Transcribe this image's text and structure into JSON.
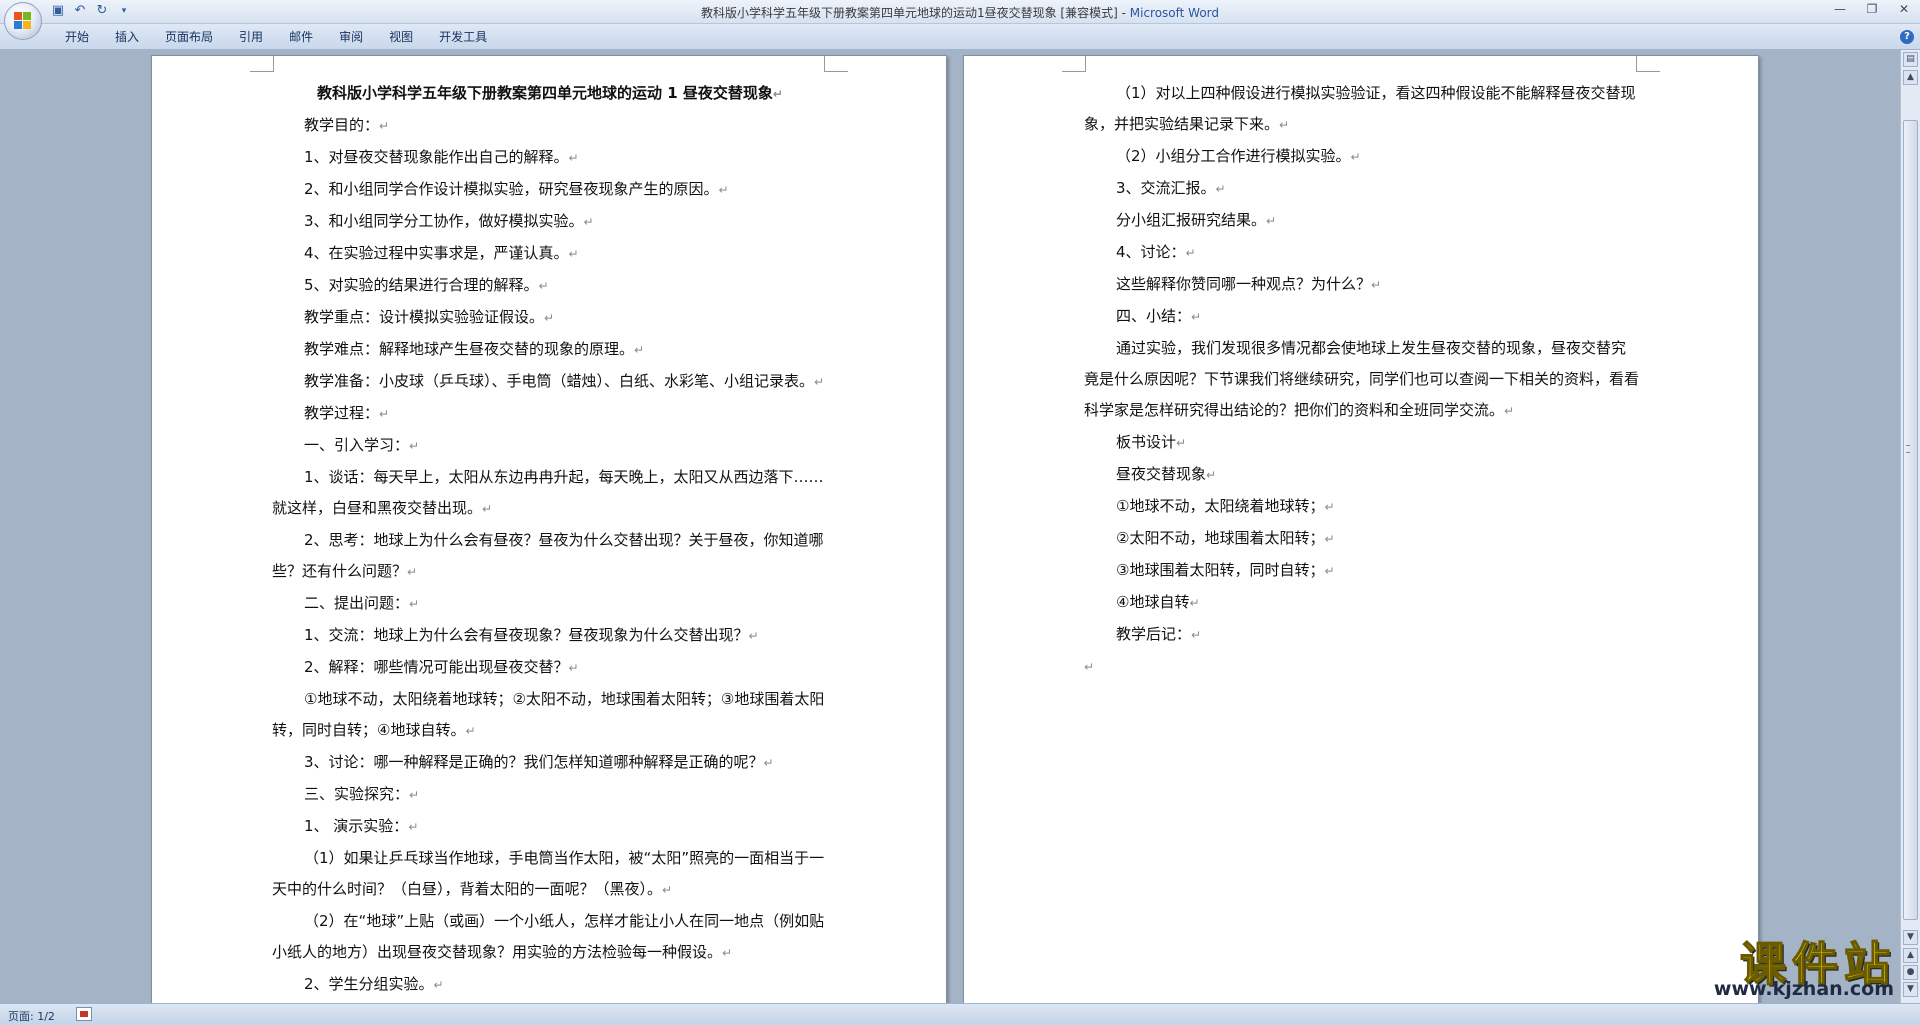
{
  "window": {
    "title_doc": "教科版小学科学五年级下册教案第四单元地球的运动1昼夜交替现象 [兼容模式] - ",
    "title_app": "Microsoft Word"
  },
  "ribbon": {
    "tabs": [
      "开始",
      "插入",
      "页面布局",
      "引用",
      "邮件",
      "审阅",
      "视图",
      "开发工具"
    ]
  },
  "pilcrow": "↵",
  "page1": {
    "paragraphs": [
      {
        "text": "教科版小学科学五年级下册教案第四单元地球的运动 1 昼夜交替现象",
        "style": "title"
      },
      {
        "text": "教学目的：",
        "style": ""
      },
      {
        "text": "1、对昼夜交替现象能作出自己的解释。",
        "style": ""
      },
      {
        "text": "2、和小组同学合作设计模拟实验，研究昼夜现象产生的原因。",
        "style": ""
      },
      {
        "text": "3、和小组同学分工协作，做好模拟实验。",
        "style": ""
      },
      {
        "text": "4、在实验过程中实事求是，严谨认真。",
        "style": ""
      },
      {
        "text": "5、对实验的结果进行合理的解释。",
        "style": ""
      },
      {
        "text": "教学重点：设计模拟实验验证假设。",
        "style": ""
      },
      {
        "text": "教学难点：解释地球产生昼夜交替的现象的原理。",
        "style": ""
      },
      {
        "text": "教学准备：小皮球（乒乓球）、手电筒（蜡烛）、白纸、水彩笔、小组记录表。",
        "style": ""
      },
      {
        "text": "教学过程：",
        "style": ""
      },
      {
        "text": "一、引入学习：",
        "style": ""
      },
      {
        "text": "1、谈话：每天早上，太阳从东边冉冉升起，每天晚上，太阳又从西边落下……就这样，白昼和黑夜交替出现。",
        "style": ""
      },
      {
        "text": "2、思考：地球上为什么会有昼夜？昼夜为什么交替出现？关于昼夜，你知道哪些？还有什么问题？",
        "style": ""
      },
      {
        "text": "二、提出问题：",
        "style": ""
      },
      {
        "text": "1、交流：地球上为什么会有昼夜现象？昼夜现象为什么交替出现？",
        "style": ""
      },
      {
        "text": "2、解释：哪些情况可能出现昼夜交替？",
        "style": ""
      },
      {
        "text": "①地球不动，太阳绕着地球转；②太阳不动，地球围着太阳转；③地球围着太阳转，同时自转；④地球自转。",
        "style": ""
      },
      {
        "text": "3、讨论：哪一种解释是正确的？我们怎样知道哪种解释是正确的呢？",
        "style": ""
      },
      {
        "text": "三、实验探究：",
        "style": ""
      },
      {
        "text": "1、 演示实验：",
        "style": ""
      },
      {
        "text": "（1）如果让乒乓球当作地球，手电筒当作太阳，被“太阳”照亮的一面相当于一天中的什么时间？（白昼），背着太阳的一面呢？（黑夜）。",
        "style": ""
      },
      {
        "text": "（2）在“地球”上贴（或画）一个小纸人，怎样才能让小人在同一地点（例如贴小纸人的地方）出现昼夜交替现象？用实验的方法检验每一种假设。",
        "style": ""
      },
      {
        "text": "2、学生分组实验。",
        "style": ""
      }
    ]
  },
  "page2": {
    "paragraphs": [
      {
        "text": "（1）对以上四种假设进行模拟实验验证，看这四种假设能不能解释昼夜交替现象，并把实验结果记录下来。",
        "style": ""
      },
      {
        "text": "（2）小组分工合作进行模拟实验。",
        "style": ""
      },
      {
        "text": "3、交流汇报。",
        "style": ""
      },
      {
        "text": "分小组汇报研究结果。",
        "style": ""
      },
      {
        "text": "4、讨论：",
        "style": ""
      },
      {
        "text": "这些解释你赞同哪一种观点？为什么？",
        "style": ""
      },
      {
        "text": "四、小结：",
        "style": ""
      },
      {
        "text": "通过实验，我们发现很多情况都会使地球上发生昼夜交替的现象，昼夜交替究竟是什么原因呢？下节课我们将继续研究，同学们也可以查阅一下相关的资料，看看科学家是怎样研究得出结论的？把你们的资料和全班同学交流。",
        "style": ""
      },
      {
        "text": "板书设计",
        "style": ""
      },
      {
        "text": "昼夜交替现象",
        "style": ""
      },
      {
        "text": "①地球不动，太阳绕着地球转；",
        "style": ""
      },
      {
        "text": "②太阳不动，地球围着太阳转；",
        "style": ""
      },
      {
        "text": "③地球围着太阳转，同时自转；",
        "style": ""
      },
      {
        "text": "④地球自转",
        "style": ""
      },
      {
        "text": "教学后记：",
        "style": ""
      },
      {
        "text": "",
        "style": "empty"
      }
    ]
  },
  "statusbar": {
    "page_info": "页面: 1/2"
  },
  "watermark": {
    "cn": "课件站",
    "url": "www.kjzhan.com"
  },
  "colors": {
    "app_title": "#2b56a3",
    "watermark_yellow": "#f6e20a"
  }
}
